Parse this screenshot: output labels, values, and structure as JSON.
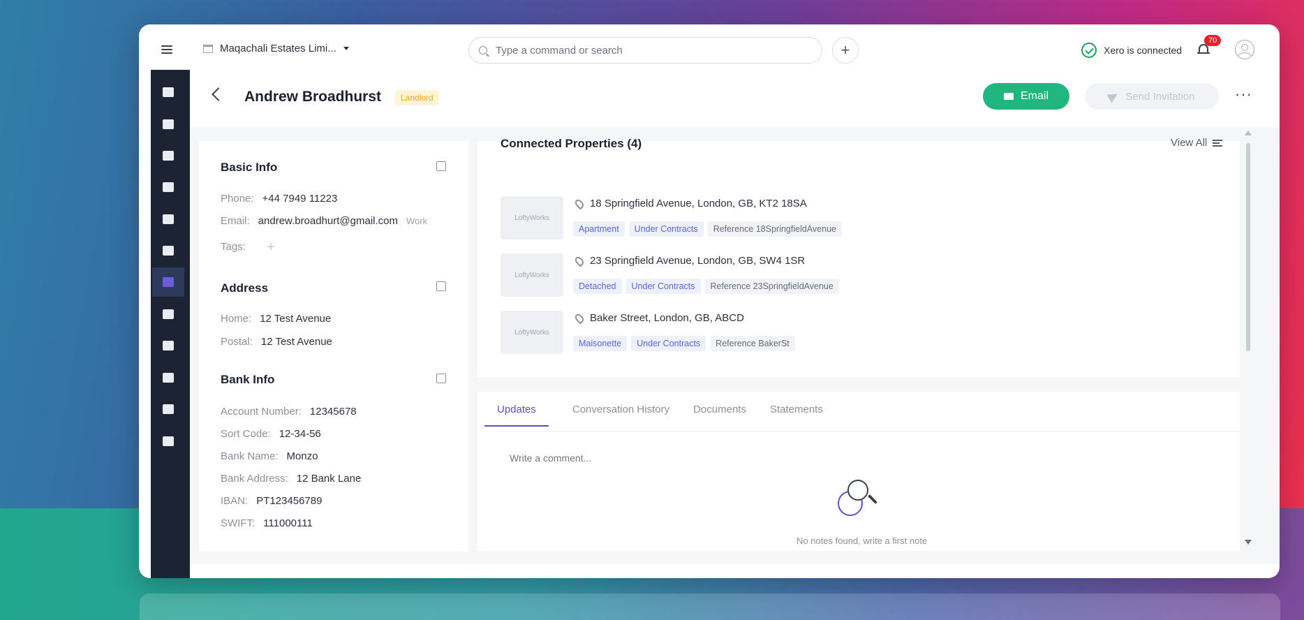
{
  "topbar": {
    "company_name": "Maqachali Estates Limi...",
    "search_placeholder": "Type a command or search",
    "xero_status": "Xero is connected",
    "notification_count": "70"
  },
  "header": {
    "name": "Andrew Broadhurst",
    "role": "Landlord",
    "email_button": "Email",
    "invite_button": "Send Invitation",
    "more": "···"
  },
  "basic_info": {
    "title": "Basic Info",
    "phone_label": "Phone:",
    "phone": "+44 7949 11223",
    "email_label": "Email:",
    "email": "andrew.broadhurt@gmail.com",
    "email_tag": "Work",
    "tags_label": "Tags:"
  },
  "address": {
    "title": "Address",
    "home_label": "Home:",
    "home": "12 Test Avenue",
    "postal_label": "Postal:",
    "postal": "12 Test Avenue"
  },
  "bank_info": {
    "title": "Bank Info",
    "account_label": "Account Number:",
    "account": "12345678",
    "sort_label": "Sort Code:",
    "sort": "12-34-56",
    "bank_name_label": "Bank Name:",
    "bank_name": "Monzo",
    "bank_address_label": "Bank Address:",
    "bank_address": "12 Bank Lane",
    "iban_label": "IBAN:",
    "iban": "PT123456789",
    "swift_label": "SWIFT:",
    "swift": "111000111"
  },
  "connected": {
    "title": "Connected Properties (4)",
    "view_all": "View All",
    "thumb_label": "LoftyWorks",
    "properties": [
      {
        "address": "18 Springfield Avenue, London, GB, KT2 18SA",
        "type": "Apartment",
        "status": "Under Contracts",
        "reference": "Reference 18SpringfieldAvenue"
      },
      {
        "address": "23 Springfield Avenue, London, GB, SW4 1SR",
        "type": "Detached",
        "status": "Under Contracts",
        "reference": "Reference 23SpringfieldAvenue"
      },
      {
        "address": "Baker Street, London, GB, ABCD",
        "type": "Maisonette",
        "status": "Under Contracts",
        "reference": "Reference BakerSt"
      }
    ]
  },
  "tabs": {
    "items": [
      "Updates",
      "Conversation History",
      "Documents",
      "Statements"
    ],
    "comment_placeholder": "Write a comment...",
    "empty_text": "No notes found, write a first note"
  }
}
